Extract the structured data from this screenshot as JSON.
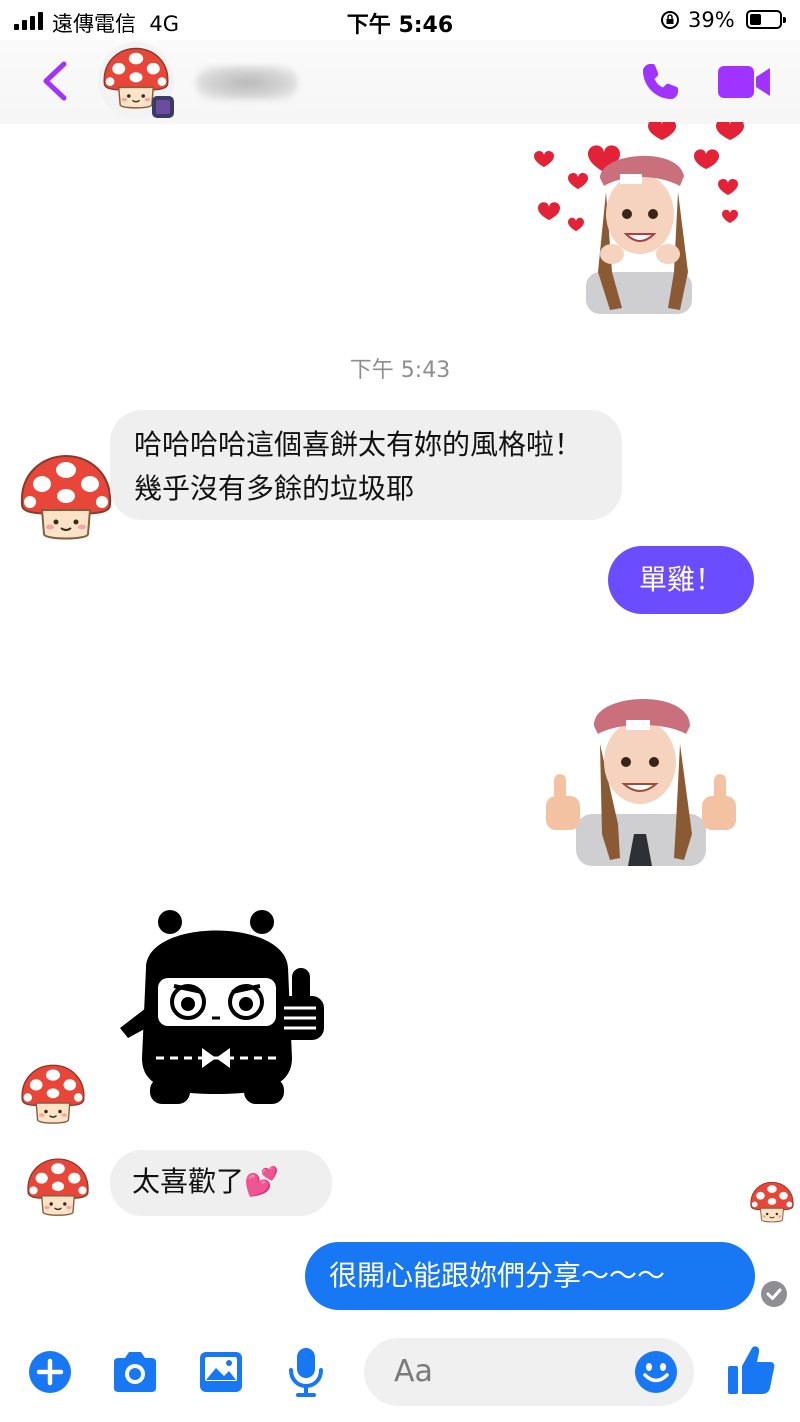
{
  "status_bar": {
    "carrier": "遠傳電信",
    "network": "4G",
    "time": "下午 5:46",
    "battery": "39%"
  },
  "header": {
    "contact_name": "",
    "icons": [
      "back-chevron-icon",
      "phone-icon",
      "video-camera-icon"
    ],
    "accent_color": "#a033ff"
  },
  "conversation": {
    "timestamp": "下午 5:43",
    "messages": [
      {
        "from": "contact",
        "type": "text",
        "text": "哈哈哈哈這個喜餅太有妳的風格啦！幾乎沒有多餘的垃圾耶"
      },
      {
        "from": "me",
        "type": "text",
        "text": "單雞！"
      },
      {
        "from": "me",
        "type": "sticker",
        "sticker": "avatar-thumbs-up"
      },
      {
        "from": "contact",
        "type": "sticker",
        "sticker": "black-bear-thumbs-up"
      },
      {
        "from": "contact",
        "type": "text",
        "text": "太喜歡了💕"
      },
      {
        "from": "me",
        "type": "text",
        "text": "很開心能跟妳們分享～～～"
      }
    ],
    "bubble_colors": {
      "incoming": "#efefef",
      "outgoing_purple": "#6b4dff",
      "outgoing_blue": "#1877f2"
    }
  },
  "composer": {
    "placeholder": "Aa",
    "icons": [
      "plus-icon",
      "camera-icon",
      "image-icon",
      "microphone-icon",
      "emoji-icon",
      "thumbs-up-icon"
    ],
    "icon_color": "#1877f2"
  }
}
